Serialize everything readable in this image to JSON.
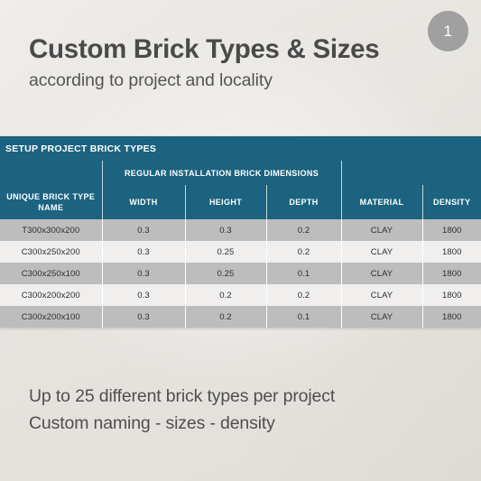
{
  "badge": {
    "number": "1"
  },
  "heading": {
    "title": "Custom Brick Types & Sizes",
    "subtitle": "according to project and locality"
  },
  "table": {
    "banner_title": "SETUP PROJECT BRICK TYPES",
    "group_header": "REGULAR INSTALLATION BRICK DIMENSIONS",
    "columns": [
      "UNIQUE BRICK TYPE NAME",
      "WIDTH",
      "HEIGHT",
      "DEPTH",
      "MATERIAL",
      "DENSITY"
    ],
    "rows": [
      {
        "name": "T300x300x200",
        "width": "0.3",
        "height": "0.3",
        "depth": "0.2",
        "material": "CLAY",
        "density": "1800"
      },
      {
        "name": "C300x250x200",
        "width": "0.3",
        "height": "0.25",
        "depth": "0.2",
        "material": "CLAY",
        "density": "1800"
      },
      {
        "name": "C300x250x100",
        "width": "0.3",
        "height": "0.25",
        "depth": "0.1",
        "material": "CLAY",
        "density": "1800"
      },
      {
        "name": "C300x200x200",
        "width": "0.3",
        "height": "0.2",
        "depth": "0.2",
        "material": "CLAY",
        "density": "1800"
      },
      {
        "name": "C300x200x100",
        "width": "0.3",
        "height": "0.2",
        "depth": "0.1",
        "material": "CLAY",
        "density": "1800"
      }
    ]
  },
  "bottom": {
    "line1": "Up to 25 different brick types per project",
    "line2": "Custom naming - sizes - density"
  },
  "colors": {
    "header_teal": "#1b6380",
    "badge_gray": "#a0a0a0",
    "row_odd": "#bdbdbd",
    "row_even": "#f0efee",
    "background": "#e9e7e3",
    "text_dark": "#4a4a4a"
  }
}
